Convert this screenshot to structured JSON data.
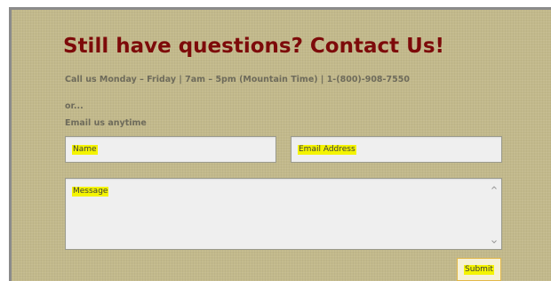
{
  "contact": {
    "heading": "Still have questions? Contact Us!",
    "call_line": "Call us Monday – Friday  |  7am – 5pm (Mountain Time)  |  1-(800)-908-7550",
    "or_text": "or...",
    "email_line": "Email us anytime"
  },
  "form": {
    "name_placeholder": "Name",
    "email_placeholder": "Email Address",
    "message_placeholder": "Message",
    "submit_label": "Submit"
  },
  "colors": {
    "background": "#c2b98b",
    "heading": "#7d0a0a",
    "text": "#6e6b5b",
    "highlight": "#f4f400",
    "submit_border": "#e2b84a"
  },
  "icons": {
    "scroll_up": "chevron-up-icon",
    "scroll_down": "chevron-down-icon"
  }
}
